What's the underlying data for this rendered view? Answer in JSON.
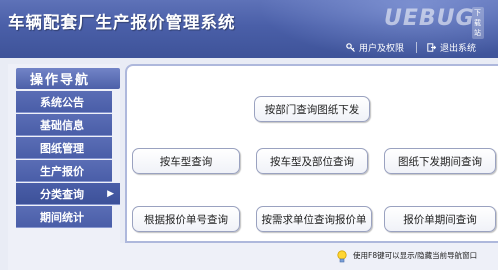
{
  "header": {
    "title": "车辆配套厂生产报价管理系统",
    "logo_text": "UEBUG",
    "logo_tag": "下载站",
    "links": [
      {
        "label": "用户及权限",
        "icon": "user-key-icon"
      },
      {
        "label": "退出系统",
        "icon": "exit-icon"
      }
    ]
  },
  "sidebar": {
    "title": "操作导航",
    "items": [
      {
        "label": "系统公告"
      },
      {
        "label": "基础信息"
      },
      {
        "label": "图纸管理"
      },
      {
        "label": "生产报价"
      },
      {
        "label": "分类查询"
      },
      {
        "label": "期间统计"
      }
    ],
    "active_index": 4
  },
  "main": {
    "buttons": [
      {
        "label": "按部门查询图纸下发"
      },
      {
        "label": "按车型查询"
      },
      {
        "label": "按车型及部位查询"
      },
      {
        "label": "图纸下发期间查询"
      },
      {
        "label": "根据报价单号查询"
      },
      {
        "label": "按需求单位查询报价单"
      },
      {
        "label": "报价单期间查询"
      }
    ]
  },
  "status": {
    "text": "使用F8键可以显示/隐藏当前导航窗口",
    "icon": "lightbulb-icon"
  },
  "colors": {
    "header_bg": "#4a5fa8",
    "nav_bg": "#5a6db5",
    "panel_border": "#aeb8dc"
  }
}
